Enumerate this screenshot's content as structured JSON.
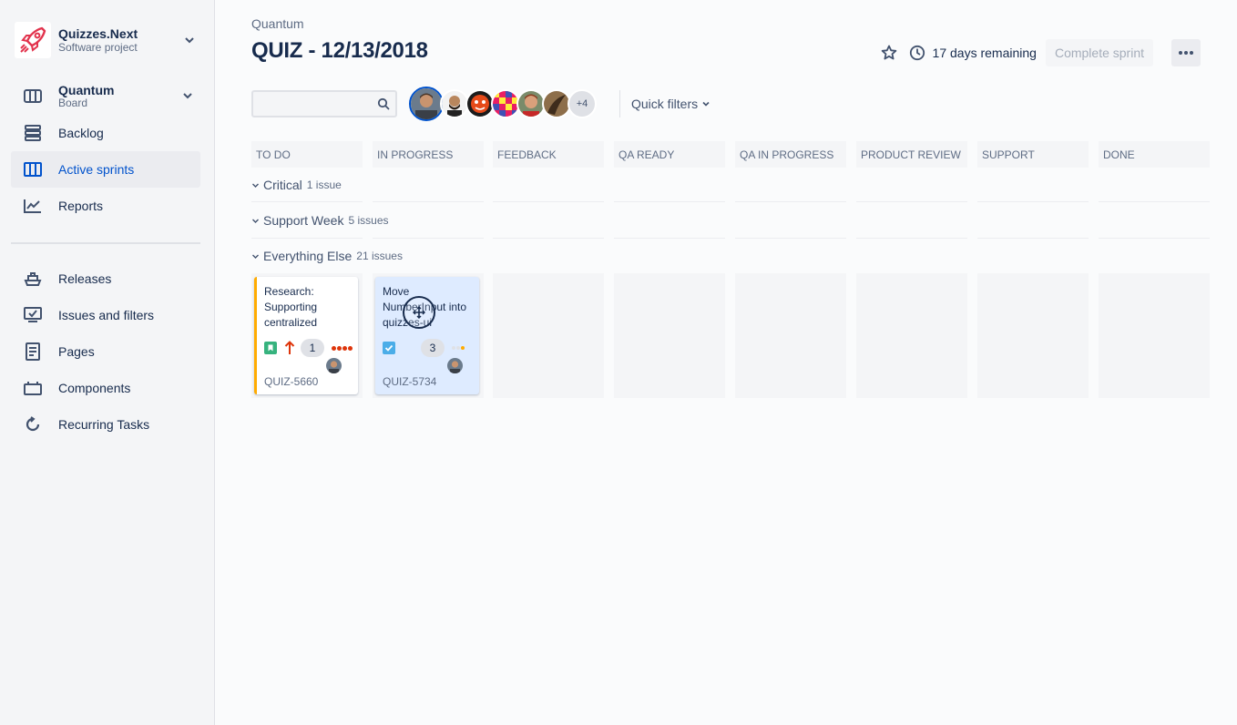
{
  "sidebar": {
    "project": {
      "name": "Quizzes.Next",
      "type": "Software project",
      "logo_color": "#e2334d"
    },
    "board": {
      "name": "Quantum",
      "sub": "Board"
    },
    "items": [
      {
        "label": "Backlog",
        "icon": "backlog-icon"
      },
      {
        "label": "Active sprints",
        "icon": "active-sprints-icon",
        "active": true
      },
      {
        "label": "Reports",
        "icon": "reports-icon"
      }
    ],
    "items2": [
      {
        "label": "Releases",
        "icon": "releases-icon"
      },
      {
        "label": "Issues and filters",
        "icon": "issues-icon"
      },
      {
        "label": "Pages",
        "icon": "pages-icon"
      },
      {
        "label": "Components",
        "icon": "components-icon"
      },
      {
        "label": "Recurring Tasks",
        "icon": "recurring-icon"
      }
    ]
  },
  "header": {
    "breadcrumb": "Quantum",
    "title": "QUIZ - 12/13/2018",
    "remaining": "17 days remaining",
    "complete_label": "Complete sprint"
  },
  "filters": {
    "more_avatars": "+4",
    "quick_filters": "Quick filters"
  },
  "columns": [
    "TO DO",
    "IN PROGRESS",
    "FEEDBACK",
    "QA READY",
    "QA IN PROGRESS",
    "PRODUCT REVIEW",
    "SUPPORT",
    "DONE"
  ],
  "swimlanes": [
    {
      "name": "Critical",
      "count": "1 issue"
    },
    {
      "name": "Support Week",
      "count": "5 issues"
    },
    {
      "name": "Everything Else",
      "count": "21 issues"
    }
  ],
  "cards": [
    {
      "summary": "Research: Supporting centralized",
      "estimate": "1",
      "key": "QUIZ-5660",
      "type": "story",
      "priority": "highest"
    },
    {
      "summary": "Move NumberInput into quizzes-ui",
      "estimate": "3",
      "key": "QUIZ-5734",
      "type": "task",
      "priority": "medium"
    }
  ],
  "colors": {
    "accent": "#0052cc",
    "story": "#36b37e",
    "task": "#4bade8",
    "flag": "#ffab00",
    "priority_high": "#de350b"
  }
}
